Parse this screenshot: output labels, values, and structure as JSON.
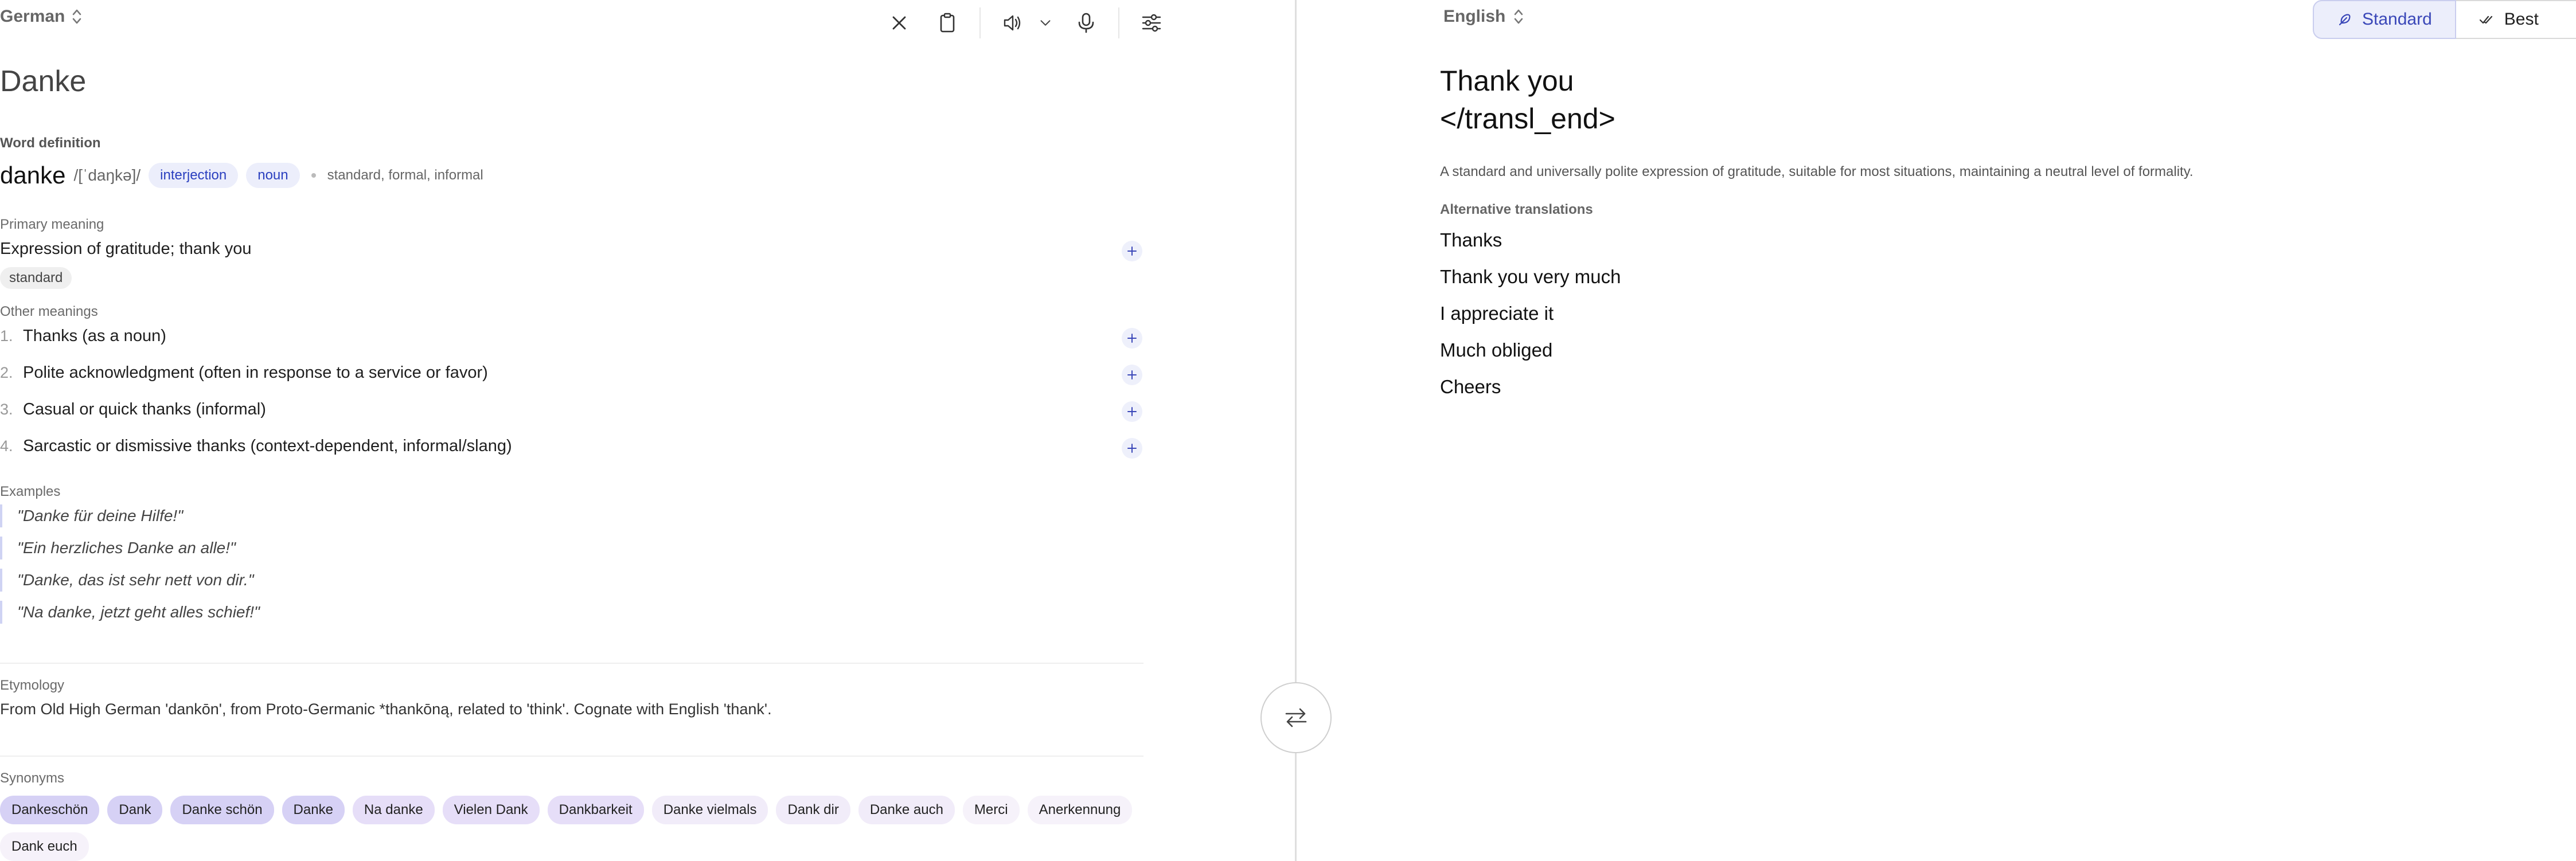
{
  "source": {
    "language": "German",
    "text": "Danke",
    "toolbar": {
      "clear": "close-icon",
      "paste": "clipboard-icon",
      "speak": "speaker-icon",
      "speak_options": "chevron-down-icon",
      "dictate": "microphone-icon",
      "settings": "sliders-icon"
    }
  },
  "definition": {
    "section_label": "Word definition",
    "word": "danke",
    "ipa": "/[ˈdaŋkə]/",
    "parts_of_speech": [
      "interjection",
      "noun"
    ],
    "registers": "standard, formal, informal",
    "primary_label": "Primary meaning",
    "primary_meaning": "Expression of gratitude; thank you",
    "primary_tag": "standard",
    "other_label": "Other meanings",
    "other_meanings": [
      {
        "num": "1.",
        "text": "Thanks (as a noun)"
      },
      {
        "num": "2.",
        "text": "Polite acknowledgment (often in response to a service or favor)"
      },
      {
        "num": "3.",
        "text": "Casual or quick thanks (informal)"
      },
      {
        "num": "4.",
        "text": "Sarcastic or dismissive thanks (context-dependent, informal/slang)"
      }
    ],
    "examples_label": "Examples",
    "examples": [
      "\"Danke für deine Hilfe!\"",
      "\"Ein herzliches Danke an alle!\"",
      "\"Danke, das ist sehr nett von dir.\"",
      "\"Na danke, jetzt geht alles schief!\""
    ],
    "etymology_label": "Etymology",
    "etymology": "From Old High German 'dankōn', from Proto-Germanic *thankōną, related to 'think'. Cognate with English 'thank'.",
    "synonyms_label": "Synonyms",
    "synonyms": [
      "Dankeschön",
      "Dank",
      "Danke schön",
      "Danke",
      "Na danke",
      "Vielen Dank",
      "Dankbarkeit",
      "Danke vielmals",
      "Dank dir",
      "Danke auch",
      "Merci",
      "Anerkennung",
      "Dank euch"
    ]
  },
  "target": {
    "language": "English",
    "modes": [
      "Standard",
      "Best"
    ],
    "active_mode": "Standard",
    "translation_line1": "Thank you",
    "translation_line2": "</transl_end>",
    "description": "A standard and universally polite expression of gratitude, suitable for most situations, maintaining a neutral level of formality.",
    "alternatives_label": "Alternative translations",
    "alternatives": [
      "Thanks",
      "Thank you very much",
      "I appreciate it",
      "Much obliged",
      "Cheers"
    ]
  },
  "colors": {
    "accent": "#3a47b8",
    "accent_bg": "#eceefb",
    "divider": "#dedede"
  }
}
